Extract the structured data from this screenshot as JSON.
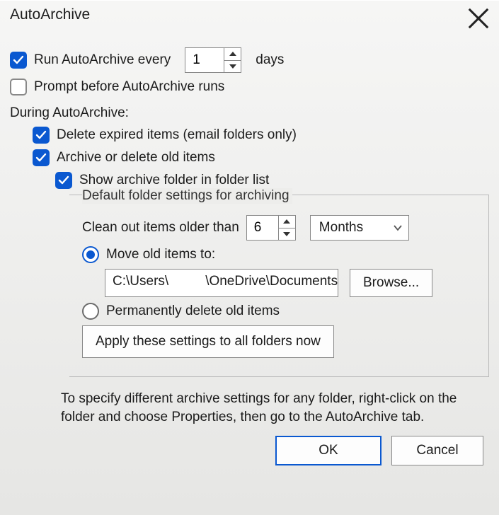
{
  "title": "AutoArchive",
  "run_every_label_pre": "Run AutoArchive every",
  "run_every_value": "1",
  "run_every_label_post": "days",
  "prompt_label": "Prompt before AutoArchive runs",
  "during_heading": "During AutoArchive:",
  "delete_expired_label": "Delete expired items (email folders only)",
  "archive_delete_label": "Archive or delete old items",
  "show_folder_label": "Show archive folder in folder list",
  "group_legend": "Default folder settings for archiving",
  "clean_label": "Clean out items older than",
  "clean_value": "6",
  "clean_unit": "Months",
  "move_label": "Move old items to:",
  "move_path_pre": "C:\\Users\\",
  "move_path_post": "\\OneDrive\\Documents\\Ou",
  "browse_label": "Browse...",
  "perm_delete_label": "Permanently delete old items",
  "apply_label": "Apply these settings to all folders now",
  "footer_text": "To specify different archive settings for any folder, right-click on the folder and choose Properties, then go to the AutoArchive tab.",
  "ok_label": "OK",
  "cancel_label": "Cancel",
  "checks": {
    "run_every": true,
    "prompt": false,
    "delete_expired": true,
    "archive_delete": true,
    "show_folder": true
  },
  "radios": {
    "move": true,
    "perm": false
  }
}
